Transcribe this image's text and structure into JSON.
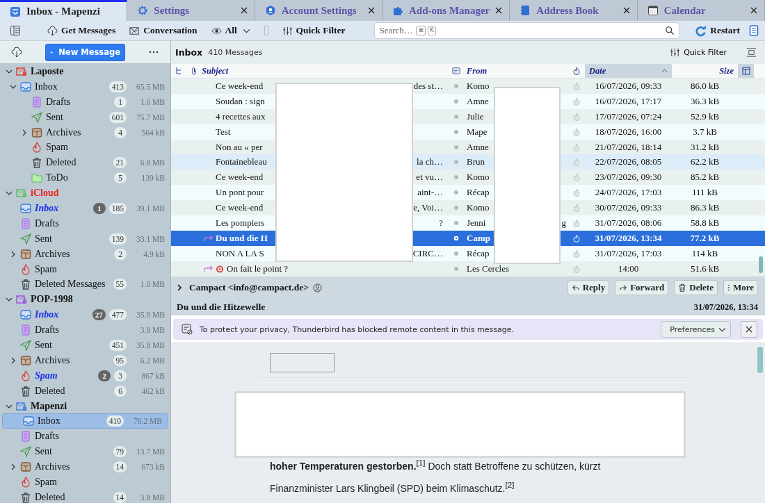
{
  "tabs": [
    {
      "kind": "mail",
      "label": "Inbox - Mapenzi",
      "selected": true
    },
    {
      "kind": "gear",
      "label": "Settings",
      "selected": false
    },
    {
      "kind": "account",
      "label": "Account Settings",
      "selected": false
    },
    {
      "kind": "puzzle",
      "label": "Add-ons Manager",
      "selected": false
    },
    {
      "kind": "book",
      "label": "Address Book",
      "selected": false
    },
    {
      "kind": "calendar",
      "label": "Calendar",
      "selected": false
    }
  ],
  "toolbar": {
    "get_messages": "Get Messages",
    "conversation": "Conversation",
    "view": "All",
    "quick_filter": "Quick Filter",
    "search": {
      "placeholder": "Search…",
      "keys": [
        "⌘",
        "K"
      ]
    },
    "restart": "Restart"
  },
  "sidebar": {
    "new_message": "New Message",
    "accounts": [
      {
        "name": "Laposte",
        "color": "#e0463c",
        "error": false,
        "expanded": true,
        "folders": [
          {
            "kind": "inbox",
            "name": "Inbox",
            "total": "413",
            "size": "65.5 MB",
            "selected": false,
            "expanded": true,
            "children": [
              {
                "kind": "drafts",
                "name": "Drafts",
                "total": "1",
                "size": "1.6 MB",
                "selected": false
              },
              {
                "kind": "sent",
                "name": "Sent",
                "total": "601",
                "size": "75.7 MB",
                "selected": false
              },
              {
                "kind": "archives",
                "name": "Archives",
                "total": "4",
                "size": "564 kB",
                "selected": false,
                "expanded": false
              },
              {
                "kind": "spam",
                "name": "Spam",
                "selected": false
              },
              {
                "kind": "trash",
                "name": "Deleted",
                "total": "21",
                "size": "6.8 MB",
                "selected": false
              },
              {
                "kind": "folder",
                "name": "ToDo",
                "total": "5",
                "size": "139 kB",
                "selected": false
              }
            ]
          }
        ]
      },
      {
        "name": "iCloud",
        "color": "#5cc45c",
        "error": true,
        "expanded": true,
        "folders": [
          {
            "kind": "inbox",
            "name": "Inbox",
            "unread": "1",
            "total": "185",
            "size": "39.1 MB",
            "selected": false
          },
          {
            "kind": "drafts",
            "name": "Drafts",
            "selected": false
          },
          {
            "kind": "sent",
            "name": "Sent",
            "total": "139",
            "size": "33.1 MB",
            "selected": false
          },
          {
            "kind": "archives",
            "name": "Archives",
            "total": "2",
            "size": "4.9 kB",
            "selected": false,
            "expanded": false
          },
          {
            "kind": "spam",
            "name": "Spam",
            "selected": false
          },
          {
            "kind": "trash",
            "name": "Deleted Messages",
            "total": "55",
            "size": "1.0 MB",
            "selected": false
          }
        ]
      },
      {
        "name": "POP-1998",
        "color": "#a05ad8",
        "error": false,
        "expanded": true,
        "folders": [
          {
            "kind": "inbox",
            "name": "Inbox",
            "unread": "27",
            "total": "477",
            "size": "35.0 MB",
            "selected": false
          },
          {
            "kind": "drafts",
            "name": "Drafts",
            "size": "3.9 MB",
            "selected": false
          },
          {
            "kind": "sent",
            "name": "Sent",
            "total": "451",
            "size": "35.8 MB",
            "selected": false
          },
          {
            "kind": "archives",
            "name": "Archives",
            "total": "95",
            "size": "6.2 MB",
            "selected": false,
            "expanded": false
          },
          {
            "kind": "spam",
            "name": "Spam",
            "unread": "2",
            "total": "3",
            "size": "867 kB",
            "selected": false
          },
          {
            "kind": "trash",
            "name": "Deleted",
            "total": "6",
            "size": "462 kB",
            "selected": false
          }
        ]
      },
      {
        "name": "Mapenzi",
        "color": "#4a7fe0",
        "error": false,
        "expanded": true,
        "folders": [
          {
            "kind": "inbox",
            "name": "Inbox",
            "total": "410",
            "size": "76.2 MB",
            "selected": true
          },
          {
            "kind": "drafts",
            "name": "Drafts",
            "selected": false
          },
          {
            "kind": "sent",
            "name": "Sent",
            "total": "79",
            "size": "13.7 MB",
            "selected": false
          },
          {
            "kind": "archives",
            "name": "Archives",
            "total": "14",
            "size": "673 kB",
            "selected": false,
            "expanded": false
          },
          {
            "kind": "spam",
            "name": "Spam",
            "selected": false
          },
          {
            "kind": "trash",
            "name": "Deleted",
            "total": "14",
            "size": "3.8 MB",
            "selected": false
          }
        ]
      }
    ]
  },
  "message_list": {
    "folder": "Inbox",
    "count": "410 Messages",
    "quick_filter": "Quick Filter"
  },
  "table": {
    "columns": [
      {
        "label": "Subject",
        "sorted": false
      },
      {
        "label": "From",
        "sorted": false
      },
      {
        "label": "Date",
        "sorted": true
      },
      {
        "label": "Size",
        "sorted": false
      }
    ],
    "rows": [
      {
        "subject": "Ce week-end",
        "subject_end": "des st…",
        "from": "Komo",
        "date": "16/07/2026, 09:33",
        "size": "86.0 kB",
        "selected": false,
        "hovered": false,
        "forwarded": false,
        "target_icon": false
      },
      {
        "subject": "Soudan : sign",
        "from": "Amne",
        "date": "16/07/2026, 17:17",
        "size": "36.3 kB",
        "selected": false,
        "hovered": false,
        "forwarded": false,
        "target_icon": false
      },
      {
        "subject": "4 recettes aux",
        "from": "Julie",
        "date": "17/07/2026, 07:24",
        "size": "52.9 kB",
        "selected": false,
        "hovered": false,
        "forwarded": false,
        "target_icon": false
      },
      {
        "subject": "Test",
        "from": "Mape",
        "date": "18/07/2026, 16:00",
        "size": "3.7 kB",
        "selected": false,
        "hovered": false,
        "forwarded": false,
        "target_icon": false
      },
      {
        "subject": "Non au « per",
        "from": "Amne",
        "date": "21/07/2026, 18:14",
        "size": "31.2 kB",
        "selected": false,
        "hovered": false,
        "forwarded": false,
        "target_icon": false
      },
      {
        "subject": "Fontainebleau",
        "subject_end": "la ch…",
        "from": "Brun",
        "date": "22/07/2026, 08:05",
        "size": "62.2 kB",
        "selected": false,
        "hovered": true,
        "forwarded": false,
        "target_icon": false
      },
      {
        "subject": "Ce week-end",
        "subject_end": "et vu…",
        "from": "Komo",
        "date": "23/07/2026, 09:30",
        "size": "85.2 kB",
        "selected": false,
        "hovered": false,
        "forwarded": false,
        "target_icon": false
      },
      {
        "subject": "Un pont pour",
        "subject_end": "aint-…",
        "from": "Récap",
        "date": "24/07/2026, 17:03",
        "size": "111 kB",
        "selected": false,
        "hovered": false,
        "forwarded": false,
        "target_icon": false
      },
      {
        "subject": "Ce week-end",
        "subject_end": "e, Voi…",
        "from": "Komo",
        "date": "30/07/2026, 09:33",
        "size": "86.3 kB",
        "selected": false,
        "hovered": false,
        "forwarded": false,
        "target_icon": false
      },
      {
        "subject": "Les pompiers",
        "subject_end": "?",
        "from": "Jenni",
        "from_end": "g",
        "date": "31/07/2026, 08:06",
        "size": "58.8 kB",
        "selected": false,
        "hovered": false,
        "forwarded": false,
        "target_icon": false
      },
      {
        "subject": "Du und die H",
        "from": "Camp",
        "date": "31/07/2026, 13:34",
        "size": "77.2 kB",
        "selected": true,
        "hovered": false,
        "forwarded": true,
        "target_icon": false
      },
      {
        "subject": "NON A LA S",
        "subject_end": "CIRC…",
        "from": "Récap",
        "date": "31/07/2026, 17:03",
        "size": "114 kB",
        "selected": false,
        "hovered": false,
        "forwarded": false,
        "target_icon": false
      },
      {
        "subject": "On fait le point ?",
        "from": "Les Cercles",
        "date": "14:00",
        "size": "51.6 kB",
        "selected": false,
        "hovered": false,
        "forwarded": true,
        "target_icon": true
      }
    ]
  },
  "message": {
    "sender": "Campact <info@campact.de>",
    "buttons": [
      {
        "kind": "reply",
        "label": "Reply"
      },
      {
        "kind": "forward",
        "label": "Forward"
      },
      {
        "kind": "delete",
        "label": "Delete"
      },
      {
        "kind": "more",
        "label": "More"
      }
    ],
    "subject": "Du und die Hitzewelle",
    "date": "31/07/2026, 13:34",
    "notice": {
      "text": "To protect your privacy, Thunderbird has blocked remote content in this message.",
      "button": "Preferences"
    },
    "body": [
      "**hoher Temperaturen gestorben.**$^{[1]}$ Doch statt Betroffene zu schützen, kürzt",
      "Finanzminister Lars Klingbeil (SPD) beim Klimaschutz.$^{[2]}$"
    ]
  }
}
